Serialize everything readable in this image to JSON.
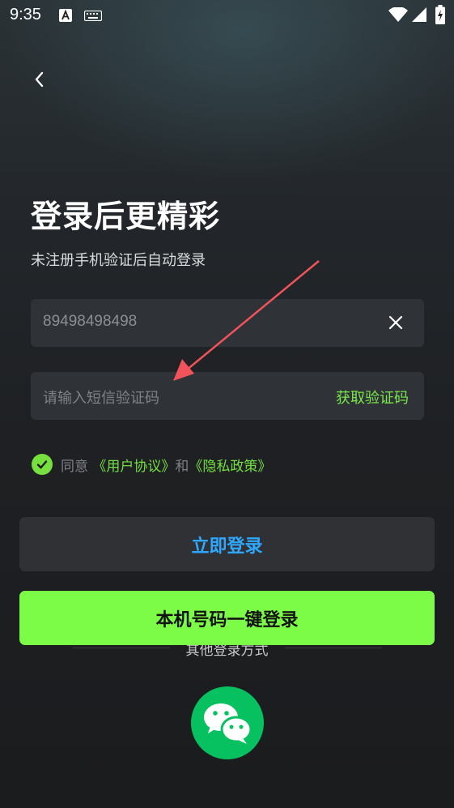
{
  "status_bar": {
    "time": "9:35"
  },
  "page": {
    "title": "登录后更精彩",
    "subtitle": "未注册手机验证后自动登录"
  },
  "phone_field": {
    "value": "89498498498"
  },
  "code_field": {
    "placeholder": "请输入短信验证码",
    "get_code_label": "获取验证码"
  },
  "agreement": {
    "prefix": "同意 ",
    "user_agreement": "《用户协议》",
    "conjunction": "和",
    "privacy_policy": "《隐私政策》",
    "checked": true
  },
  "buttons": {
    "login": "立即登录",
    "one_click_login": "本机号码一键登录"
  },
  "other_login": {
    "label": "其他登录方式",
    "options": [
      "wechat-icon"
    ]
  },
  "colors": {
    "accent_green": "#7cfc46",
    "link_green": "#74df40",
    "login_text_blue": "#2fa8ff",
    "wechat_green": "#07c160",
    "annotation_arrow": "#f0535a"
  }
}
